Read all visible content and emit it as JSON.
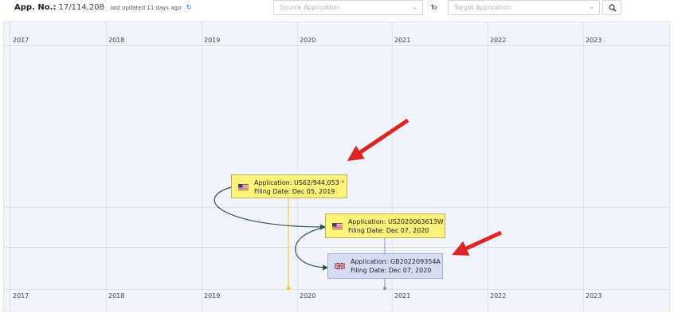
{
  "header": {
    "app_no_label": "App. No.:",
    "app_no_value": "17/114,208",
    "last_updated": "last updated 11 days ago",
    "source_placeholder": "Source Application",
    "to_label": "To",
    "target_placeholder": "Target Application"
  },
  "timeline": {
    "years": [
      "2017",
      "2018",
      "2019",
      "2020",
      "2021",
      "2022",
      "2023"
    ]
  },
  "cards": [
    {
      "flag": "us-flag-icon",
      "application": "Application: US62/944,053",
      "marker": "*",
      "filing_date": "Filing Date: Dec 05, 2019",
      "color": "#fdf27a"
    },
    {
      "flag": "us-flag-icon",
      "application": "Application: US2020063613W",
      "filing_date": "Filing Date: Dec 07, 2020",
      "color": "#fdf27a"
    },
    {
      "flag": "uk-flag-icon",
      "application": "Application: GB202209354A",
      "filing_date": "Filing Date: Dec 07, 2020",
      "color": "#d5ddf5"
    }
  ],
  "colors": {
    "annotation_arrow": "#e02424",
    "connector": "#2f4f4f",
    "filing_line_yellow": "#f5c518",
    "filing_line_blue": "#7b96e0"
  }
}
